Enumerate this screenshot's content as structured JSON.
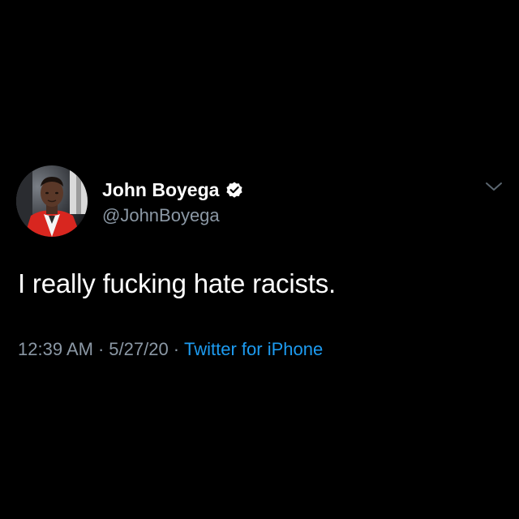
{
  "tweet": {
    "author": {
      "display_name": "John Boyega",
      "handle": "@JohnBoyega",
      "verified": true,
      "avatar_icon": "profile-photo"
    },
    "text": "I really fucking hate racists.",
    "time": "12:39 AM",
    "separator": "·",
    "date": "5/27/20",
    "source": "Twitter for iPhone",
    "menu_icon": "chevron-down-icon"
  },
  "colors": {
    "background": "#000000",
    "primary_text": "#ffffff",
    "secondary_text": "#8b98a5",
    "link": "#1d9bf0",
    "verified_badge": "#ffffff"
  }
}
